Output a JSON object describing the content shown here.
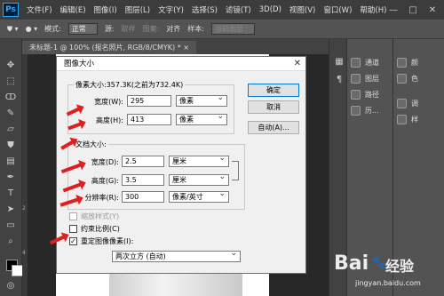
{
  "app": {
    "logo": "Ps"
  },
  "menu": [
    "文件(F)",
    "编辑(E)",
    "图像(I)",
    "图层(L)",
    "文字(Y)",
    "选择(S)",
    "滤镜(T)",
    "3D(D)",
    "视图(V)",
    "窗口(W)",
    "帮助(H)"
  ],
  "window_controls": {
    "minimize": "—",
    "restore": "□",
    "close": "✕"
  },
  "options_bar": {
    "mode_label": "模式:",
    "mode_value": "正常",
    "source_label": "源:",
    "source_option1": "取样",
    "source_option2": "图案:",
    "align_label": "对齐",
    "sample_label": "样本:",
    "sample_value": "当前图层"
  },
  "document_tab": {
    "title": "未标题-1 @ 100% (报名照片, RGB/8/CMYK) *",
    "close": "×"
  },
  "ruler_marks": [
    "2",
    "4"
  ],
  "right_panels": {
    "items": [
      {
        "icon": "channels-icon",
        "label": "通道"
      },
      {
        "icon": "layers-icon",
        "label": "图层"
      },
      {
        "icon": "paths-icon",
        "label": "路径"
      },
      {
        "icon": "history-icon",
        "label": "历..."
      }
    ],
    "items2": [
      {
        "label": "颜"
      },
      {
        "label": "色"
      },
      {
        "label": "调"
      },
      {
        "label": "样"
      }
    ]
  },
  "dialog": {
    "title": "图像大小",
    "close": "✕",
    "pixel_group": {
      "title": "像素大小:357.3K(之前为732.4K)",
      "width_label": "宽度(W):",
      "width_value": "295",
      "width_unit": "像素",
      "height_label": "高度(H):",
      "height_value": "413",
      "height_unit": "像素"
    },
    "doc_group": {
      "title": "文档大小:",
      "width_label": "宽度(D):",
      "width_value": "2.5",
      "width_unit": "厘米",
      "height_label": "高度(G):",
      "height_value": "3.5",
      "height_unit": "厘米",
      "res_label": "分辨率(R):",
      "res_value": "300",
      "res_unit": "像素/英寸"
    },
    "buttons": {
      "ok": "确定",
      "cancel": "取消",
      "auto": "自动(A)..."
    },
    "options": {
      "scale_styles": "缩放样式(Y)",
      "constrain": "约束比例(C)",
      "resample": "重定图像像素(I):",
      "resample_method": "两次立方 (自动)"
    }
  },
  "watermark": {
    "brand": "Bai",
    "paw": "du",
    "cn": "经验",
    "url": "jingyan.baidu.com"
  },
  "colors": {
    "arrow": "#e02020",
    "dialog_bg": "#f0f0f0",
    "ps_blue": "#31a8ff"
  }
}
